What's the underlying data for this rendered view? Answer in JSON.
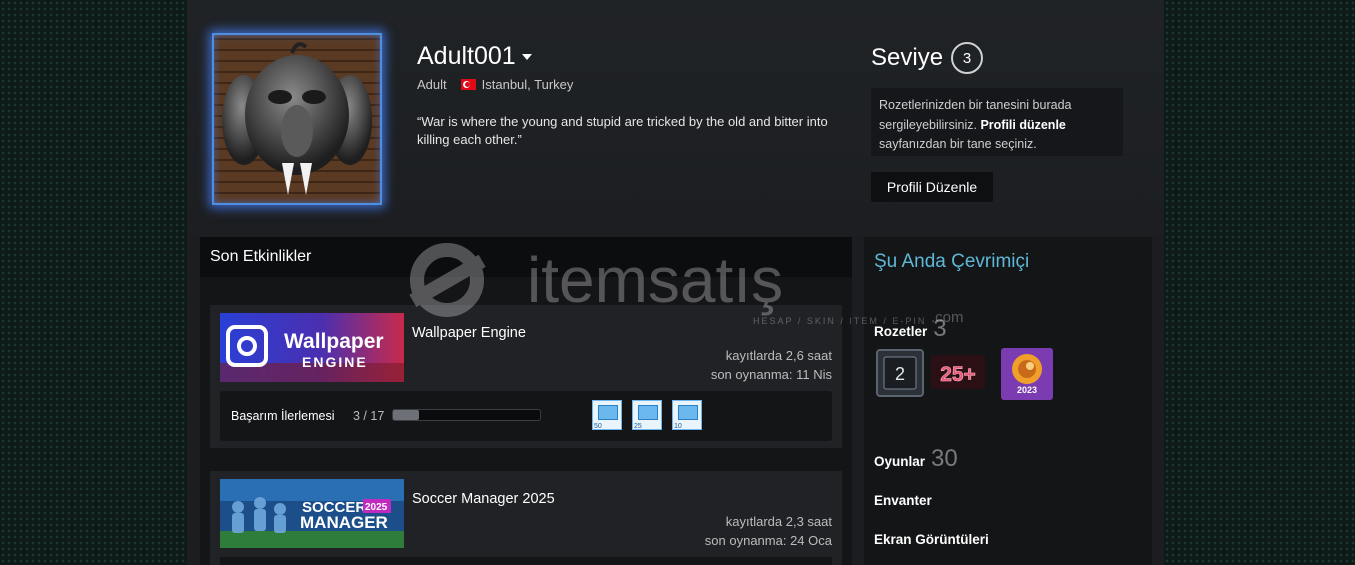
{
  "profile": {
    "persona_name": "Adult001",
    "real_name": "Adult",
    "location": "Istanbul, Turkey",
    "summary": "“War is where the young and stupid are tricked by the old and bitter into killing each other.”"
  },
  "level": {
    "label": "Seviye",
    "value": "3"
  },
  "badge_hint": {
    "text_before": "Rozetlerinizden bir tanesini burada sergileyebilirsiniz.",
    "link": "Profili düzenle",
    "text_after": "sayfanızdan bir tane seçiniz."
  },
  "edit_button": "Profili Düzenle",
  "activity": {
    "title": "Son Etkinlikler",
    "games": [
      {
        "name": "Wallpaper Engine",
        "capsule_text": [
          "Wallpaper",
          "ENGINE"
        ],
        "hours": "kayıtlarda 2,6 saat",
        "last_played": "son oynanma: 11 Nis",
        "achievement_label": "Başarım İlerlemesi",
        "achievement_count": "3 / 17",
        "achievement_progress": 0.18,
        "achievement_icons": [
          "50",
          "25",
          "10"
        ]
      },
      {
        "name": "Soccer Manager 2025",
        "capsule_text": [
          "SOCCER",
          "2025",
          "MANAGER"
        ],
        "hours": "kayıtlarda 2,3 saat",
        "last_played": "son oynanma: 24 Oca"
      }
    ]
  },
  "sidebar": {
    "online_status": "Şu Anda Çevrimiçi",
    "badges_label": "Rozetler",
    "badges_count": "3",
    "badges": [
      {
        "name": "level-2-badge",
        "text": "2"
      },
      {
        "name": "25-plus-badge",
        "text": "25+"
      },
      {
        "name": "steam-2023-badge",
        "text": "2023"
      }
    ],
    "games_label": "Oyunlar",
    "games_count": "30",
    "inventory_label": "Envanter",
    "screenshots_label": "Ekran Görüntüleri"
  },
  "watermark": {
    "brand": "itemsatış",
    "tagline": "HESAP / SKIN / ITEM / E-PIN",
    "domain": ".com"
  },
  "colors": {
    "accent_online": "#5fb8d6",
    "avatar_glow": "#4f8fe0",
    "page_bg": "#1b1d20"
  }
}
